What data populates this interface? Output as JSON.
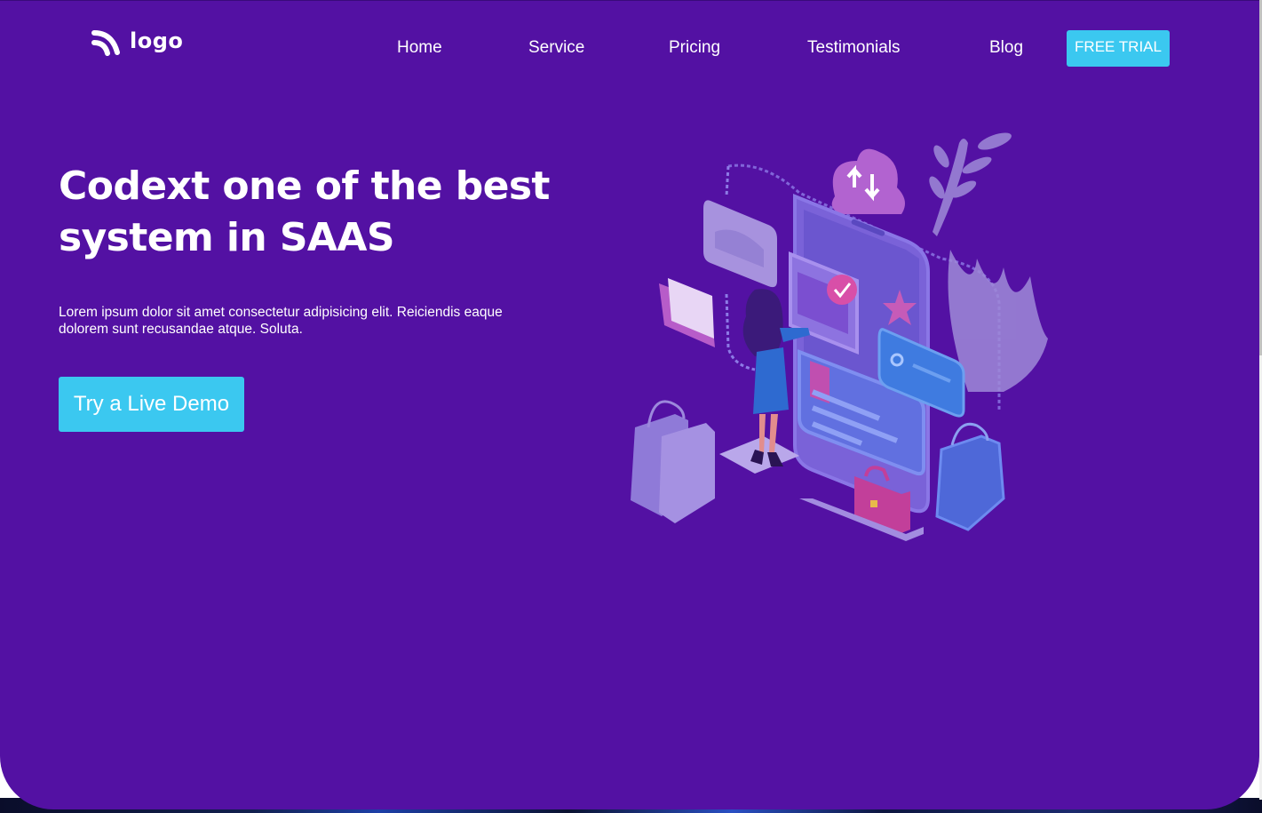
{
  "header": {
    "logo_text": "logo",
    "nav": {
      "home": "Home",
      "service": "Service",
      "pricing": "Pricing",
      "testimonials": "Testimonials",
      "blog": "Blog"
    },
    "cta_label": "FREE TRIAL"
  },
  "hero": {
    "title": "Codext one of the best system in SAAS",
    "description": "Lorem ipsum dolor sit amet consectetur adipisicing elit. Reiciendis eaque dolorem sunt recusandae atque. Soluta.",
    "button_label": "Try a Live Demo"
  },
  "colors": {
    "background": "#5311a3",
    "accent": "#3bc8f0",
    "text": "#ffffff"
  },
  "icons": {
    "logo": "rss-icon"
  }
}
